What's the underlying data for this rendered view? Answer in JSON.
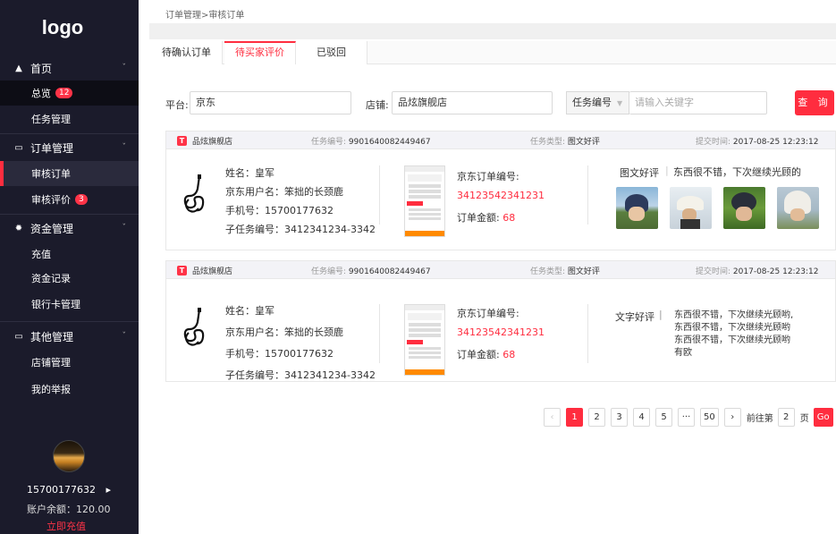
{
  "app": {
    "logo": "logo"
  },
  "sidebar": {
    "home": "首页",
    "overview": "总览",
    "overview_badge": "12",
    "task_manage": "任务管理",
    "order_manage": "订单管理",
    "audit_order": "审核订单",
    "audit_review": "审核评价",
    "audit_review_badge": "3",
    "funds_manage": "资金管理",
    "recharge": "充值",
    "funds_record": "资金记录",
    "bank_card": "银行卡管理",
    "other_manage": "其他管理",
    "shop_manage": "店铺管理",
    "my_report": "我的举报",
    "user_phone": "15700177632",
    "user_arrow": "▸",
    "balance": "账户余额：120.00",
    "recharge_now": "立即充值"
  },
  "breadcrumb": "订单管理>审核订单",
  "tabs": [
    "待确认订单",
    "待买家评价",
    "已驳回"
  ],
  "filters": {
    "platform_label": "平台:",
    "platform_value": "京东",
    "shop_label": "店铺:",
    "shop_value": "品炫旗舰店",
    "task_select": "任务编号",
    "keyword_placeholder": "请输入关键字",
    "query_button": "查 询"
  },
  "orders": [
    {
      "shop": "品炫旗舰店",
      "task_no_label": "任务编号:",
      "task_no": "9901640082449467",
      "task_type_label": "任务类型:",
      "task_type": "图文好评",
      "submit_label": "提交时间:",
      "submit_time": "2017-08-25   12:23:12",
      "name": "姓名：皇军",
      "jd_user": "京东用户名：笨拙的长颈鹿",
      "phone": "手机号：15700177632",
      "subtask": "子任务编号：3412341234-3342",
      "jd_order_label": "京东订单编号:",
      "jd_order_no": "34123542341231",
      "amount_label": "订单金额:",
      "amount": "68",
      "review_type": "图文好评",
      "review_lines": [
        "东西很不错，下次继续光顾的"
      ]
    },
    {
      "shop": "品炫旗舰店",
      "task_no_label": "任务编号:",
      "task_no": "9901640082449467",
      "task_type_label": "任务类型:",
      "task_type": "图文好评",
      "submit_label": "提交时间:",
      "submit_time": "2017-08-25   12:23:12",
      "name": "姓名：皇军",
      "jd_user": "京东用户名：笨拙的长颈鹿",
      "phone": "手机号：15700177632",
      "subtask": "子任务编号：3412341234-3342",
      "jd_order_label": "京东订单编号:",
      "jd_order_no": "34123542341231",
      "amount_label": "订单金额:",
      "amount": "68",
      "review_type": "文字好评",
      "review_lines": [
        "东西很不错，下次继续光顾哟,",
        "东西很不错，下次继续光顾哟",
        "东西很不错，下次继续光顾哟",
        "有欧"
      ]
    }
  ],
  "pagination": {
    "prev": "‹",
    "pages": [
      "1",
      "2",
      "3",
      "4",
      "5"
    ],
    "ellipsis": "···",
    "last": "50",
    "next": "›",
    "goto_prefix": "前往第",
    "goto_value": "2",
    "goto_suffix": "页",
    "go": "Go"
  },
  "colors": {
    "accent": "#ff2d3f",
    "sidebar": "#1b1b2b"
  }
}
